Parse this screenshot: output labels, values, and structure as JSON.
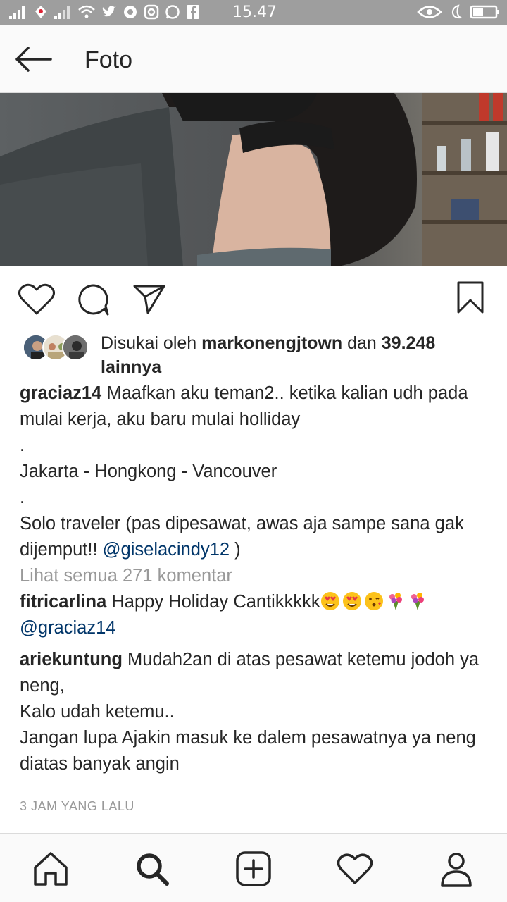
{
  "status_bar": {
    "time": "15.47"
  },
  "header": {
    "title": "Foto"
  },
  "likes": {
    "prefix": "Disukai oleh",
    "user": "markonengjtown",
    "connector": "dan",
    "count": "39.248",
    "suffix": "lainnya"
  },
  "caption": {
    "username": "graciaz14",
    "line1": "Maafkan aku teman2.. ketika kalian udh pada mulai kerja, aku baru mulai holliday",
    "dot1": ".",
    "line2": "Jakarta - Hongkong - Vancouver",
    "dot2": ".",
    "line3": "Solo traveler (pas dipesawat, awas aja sampe sana gak dijemput!!",
    "mention": "@giselacindy12",
    "close": ")"
  },
  "view_all": "Lihat semua 271 komentar",
  "comments": [
    {
      "username": "fitricarlina",
      "text": "Happy Holiday Cantikkkkk",
      "mention": "@graciaz14"
    },
    {
      "username": "ariekuntung",
      "text": "Mudah2an di atas pesawat ketemu jodoh ya neng,",
      "line2": "Kalo udah ketemu..",
      "line3": "Jangan lupa Ajakin masuk ke dalem pesawatnya ya neng diatas banyak angin"
    }
  ],
  "time_ago": "3 JAM YANG LALU",
  "icons": {
    "back": "arrow-left-icon",
    "like": "heart-icon",
    "comment": "comment-bubble-icon",
    "share": "paper-plane-icon",
    "save": "bookmark-icon",
    "nav_home": "home-icon",
    "nav_search": "search-icon",
    "nav_add": "plus-square-icon",
    "nav_activity": "heart-icon",
    "nav_profile": "person-icon"
  },
  "colors": {
    "mention": "#003569",
    "muted": "#999999",
    "statusbar": "#9e9e9e"
  }
}
